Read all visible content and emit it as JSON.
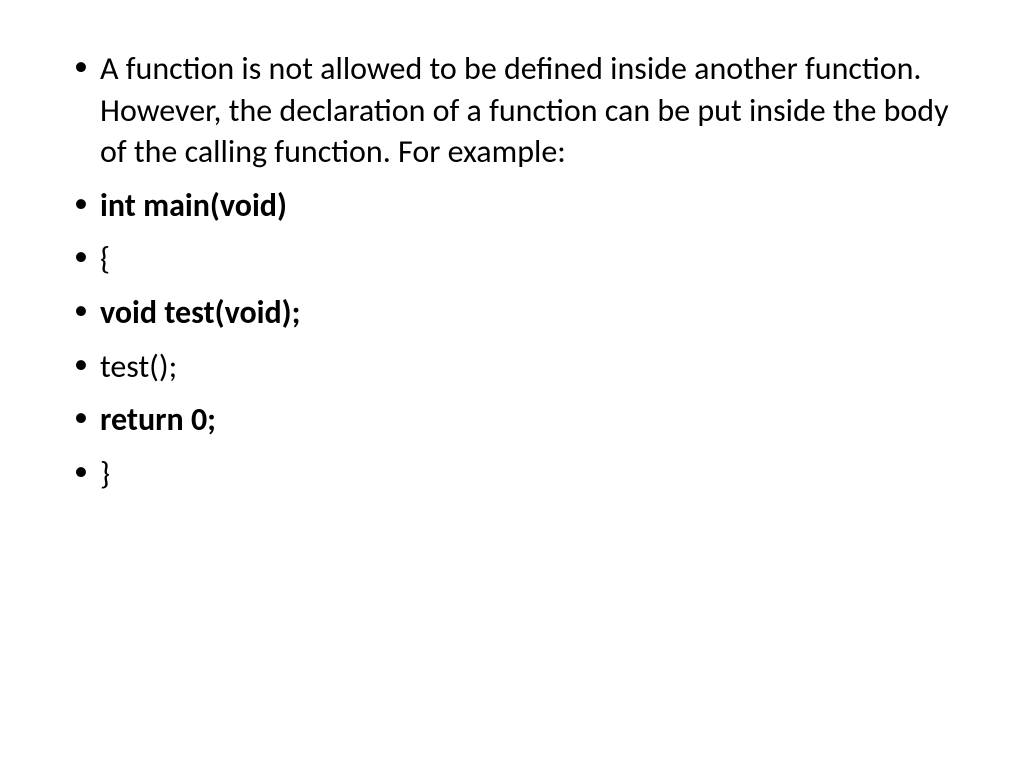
{
  "bullets": [
    {
      "text": "A function is not allowed to be defined inside another function. However, the declaration of a function can be put inside the body of the calling function. For example:",
      "bold": false
    },
    {
      "text": "int main(void)",
      "bold": true
    },
    {
      "text": "{",
      "bold": false
    },
    {
      "text": "void test(void);",
      "bold": true
    },
    {
      "text": "test();",
      "bold": false
    },
    {
      "text": "return 0;",
      "bold": true
    },
    {
      "text": "}",
      "bold": false
    }
  ]
}
